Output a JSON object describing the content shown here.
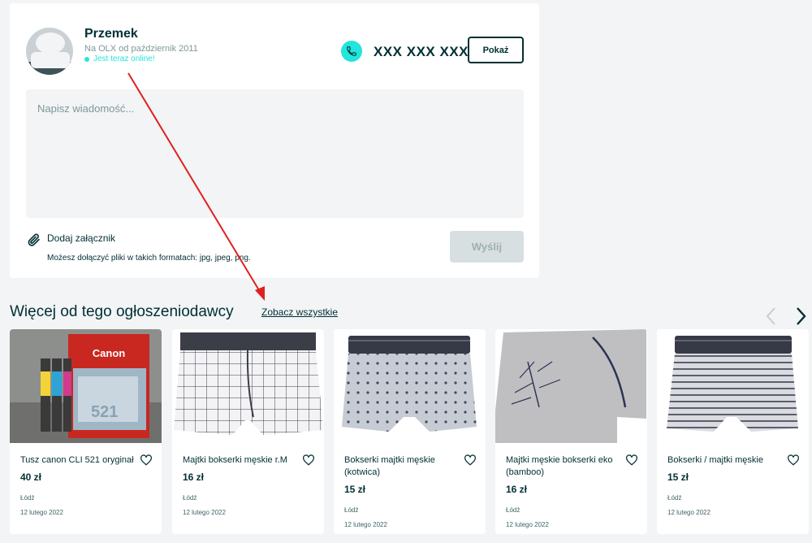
{
  "seller": {
    "name": "Przemek",
    "member_since": "Na OLX od październik 2011",
    "online_status": "Jest teraz online!",
    "phone_masked": "XXX XXX XXX",
    "show_label": "Pokaż"
  },
  "message": {
    "placeholder": "Napisz wiadomość...",
    "attach_label": "Dodaj załącznik",
    "attach_hint": "Możesz dołączyć pliki w takich formatach: jpg, jpeg, png.",
    "send_label": "Wyślij"
  },
  "more_ads": {
    "title": "Więcej od tego ogłoszeniodawcy",
    "see_all_label": "Zobacz wszystkie",
    "items": [
      {
        "title": "Tusz canon CLI 521 oryginał",
        "price": "40 zł",
        "location": "Łódź",
        "date": "12 lutego 2022"
      },
      {
        "title": "Majtki bokserki męskie r.M",
        "price": "16 zł",
        "location": "Łódź",
        "date": "12 lutego 2022"
      },
      {
        "title": "Bokserki majtki męskie (kotwica)",
        "price": "15 zł",
        "location": "Łódź",
        "date": "12 lutego 2022"
      },
      {
        "title": "Majtki męskie bokserki eko (bamboo)",
        "price": "16 zł",
        "location": "Łódź",
        "date": "12 lutego 2022"
      },
      {
        "title": "Bokserki / majtki męskie",
        "price": "15 zł",
        "location": "Łódź",
        "date": "12 lutego 2022"
      }
    ]
  },
  "icons": {
    "phone": "phone-icon",
    "attach": "paperclip-icon",
    "favorite": "heart-icon",
    "prev": "chevron-left-icon",
    "next": "chevron-right-icon"
  },
  "colors": {
    "accent": "#23e5db",
    "text": "#002f34",
    "background": "#f2f4f5",
    "annotation": "#e02020"
  }
}
